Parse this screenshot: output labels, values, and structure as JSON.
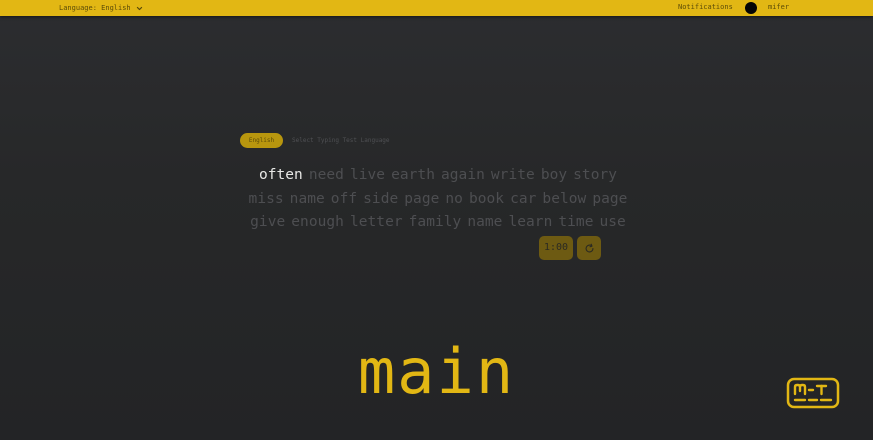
{
  "header": {
    "language_label": "Language: English",
    "notifications_label": "Notifications",
    "username": "mifer"
  },
  "typing": {
    "selected_language": "English",
    "language_hint": "Select Typing Test Language",
    "lines": [
      [
        "often",
        "need",
        "live",
        "earth",
        "again",
        "write",
        "boy",
        "story"
      ],
      [
        "miss",
        "name",
        "off",
        "side",
        "page",
        "no",
        "book",
        "car",
        "below",
        "page"
      ],
      [
        "give",
        "enough",
        "letter",
        "family",
        "name",
        "learn",
        "time",
        "use"
      ]
    ],
    "active_word": "often",
    "timer": "1:00"
  },
  "main_label": "main",
  "colors": {
    "accent": "#e2b714",
    "background": "#2a2b2d",
    "word_inactive": "#4d4e51",
    "word_active": "#e8e8e6"
  },
  "icons": {
    "language_dropdown": "chevron-down-icon",
    "restart": "refresh-icon",
    "logo": "mt-logo-icon"
  }
}
